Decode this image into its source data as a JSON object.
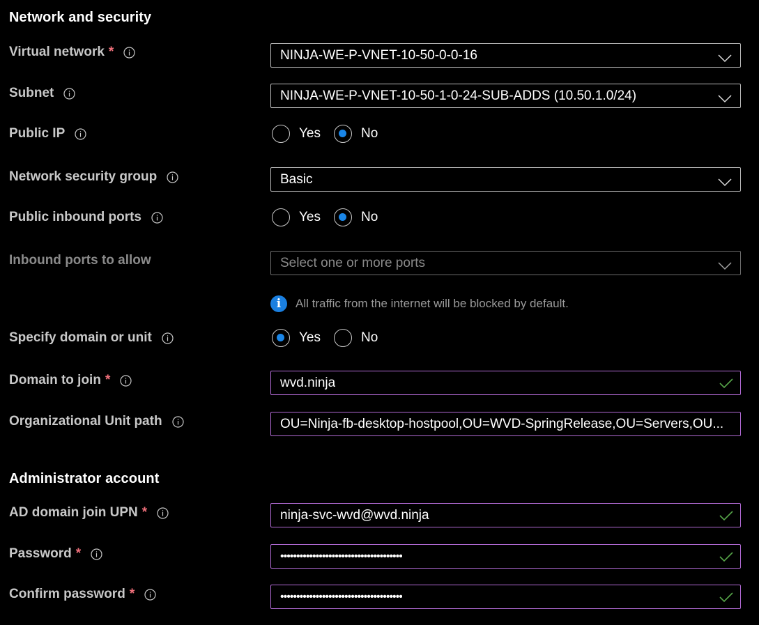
{
  "sections": {
    "network": "Network and security",
    "admin": "Administrator account"
  },
  "labels": {
    "virtual_network": "Virtual network",
    "subnet": "Subnet",
    "public_ip": "Public IP",
    "nsg": "Network security group",
    "public_inbound_ports": "Public inbound ports",
    "inbound_ports_allow": "Inbound ports to allow",
    "specify_domain": "Specify domain or unit",
    "domain_to_join": "Domain to join",
    "ou_path": "Organizational Unit path",
    "ad_upn": "AD domain join UPN",
    "password": "Password",
    "confirm_password": "Confirm password"
  },
  "required_mark": "*",
  "fields": {
    "virtual_network": "NINJA-WE-P-VNET-10-50-0-0-16",
    "subnet": "NINJA-WE-P-VNET-10-50-1-0-24-SUB-ADDS (10.50.1.0/24)",
    "nsg": "Basic",
    "inbound_ports_placeholder": "Select one or more ports",
    "domain_to_join": "wvd.ninja",
    "ou_path": "OU=Ninja-fb-desktop-hostpool,OU=WVD-SpringRelease,OU=Servers,OU...",
    "ad_upn": "ninja-svc-wvd@wvd.ninja",
    "password": "••••••••••••••••••••••••••••••••••••••",
    "confirm_password": "••••••••••••••••••••••••••••••••••••••"
  },
  "options": {
    "yes": "Yes",
    "no": "No"
  },
  "radio_state": {
    "public_ip": "No",
    "public_inbound_ports": "No",
    "specify_domain": "Yes"
  },
  "notice": {
    "icon": "i",
    "text": "All traffic from the internet will be blocked by default."
  },
  "colors": {
    "background": "#000000",
    "accent_blue": "#1a86e8",
    "valid_border": "#b36bd6",
    "check_green": "#57a64a",
    "required_red": "#f1707b"
  },
  "icons": [
    "info-icon",
    "chevron-down-icon",
    "checkmark-icon"
  ]
}
